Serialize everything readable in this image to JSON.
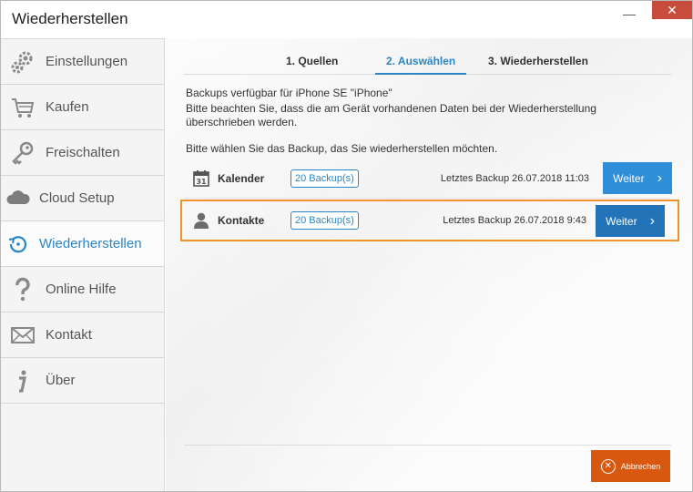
{
  "window": {
    "title": "Wiederherstellen",
    "minimize": "—",
    "close": "✕"
  },
  "sidebar": {
    "items": [
      {
        "label": "Einstellungen",
        "icon": "gear-icon"
      },
      {
        "label": "Kaufen",
        "icon": "cart-icon"
      },
      {
        "label": "Freischalten",
        "icon": "key-icon"
      },
      {
        "label": "Cloud Setup",
        "icon": "cloud-icon"
      },
      {
        "label": "Wiederherstellen",
        "icon": "restore-icon",
        "active": true
      },
      {
        "label": "Online Hilfe",
        "icon": "question-icon"
      },
      {
        "label": "Kontakt",
        "icon": "envelope-icon"
      },
      {
        "label": "Über",
        "icon": "info-icon"
      }
    ]
  },
  "steps": {
    "s1": "1. Quellen",
    "s2": "2. Auswählen",
    "s3": "3. Wiederherstellen"
  },
  "info": {
    "line1": "Backups verfügbar für iPhone SE \"iPhone\"",
    "line2": "Bitte beachten Sie, dass die am Gerät vorhandenen Daten bei der Wiederherstellung überschrieben werden.",
    "line3": "Bitte wählen Sie das Backup, das Sie wiederherstellen möchten."
  },
  "rows": [
    {
      "name": "Kalender",
      "icon": "calendar-icon",
      "badge": "20 Backup(s)",
      "last": "Letztes Backup 26.07.2018 11:03",
      "button": "Weiter"
    },
    {
      "name": "Kontakte",
      "icon": "person-icon",
      "badge": "20 Backup(s)",
      "last": "Letztes Backup 26.07.2018 9:43",
      "button": "Weiter"
    }
  ],
  "cancel": {
    "label": "Abbrechen"
  },
  "colors": {
    "accent": "#2a86c6",
    "button": "#2f8ed8",
    "highlight": "#f0922d",
    "cancel": "#d8580f"
  }
}
